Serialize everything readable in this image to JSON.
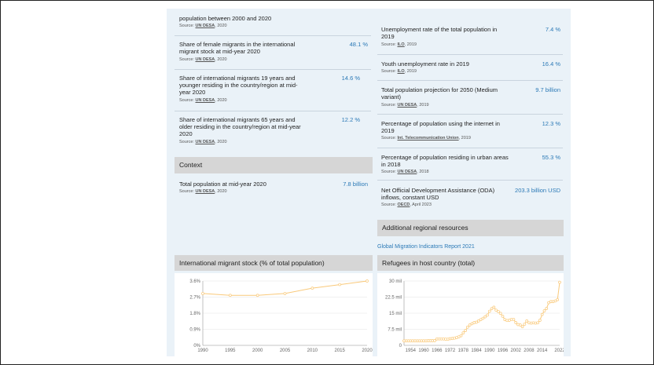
{
  "left_stats": [
    {
      "label": "population between 2000 and 2020",
      "value": "",
      "source_prefix": "Source:",
      "source_org": "UN DESA",
      "source_suffix": ", 2020"
    },
    {
      "label": "Share of female migrants in the international migrant stock at mid-year 2020",
      "value": "48.1 %",
      "source_prefix": "Source:",
      "source_org": "UN DESA",
      "source_suffix": ", 2020"
    },
    {
      "label": "Share of international migrants 19 years and younger residing in the country/region at mid-year 2020",
      "value": "14.6 %",
      "source_prefix": "Source:",
      "source_org": "UN DESA",
      "source_suffix": ", 2020"
    },
    {
      "label": "Share of international migrants 65 years and older residing in the country/region at mid-year 2020",
      "value": "12.2 %",
      "source_prefix": "Source:",
      "source_org": "UN DESA",
      "source_suffix": ", 2020"
    }
  ],
  "context": {
    "header": "Context",
    "items": [
      {
        "label": "Total population at mid-year 2020",
        "value": "7.8 billion",
        "source_prefix": "Source:",
        "source_org": "UN DESA",
        "source_suffix": ", 2020"
      }
    ]
  },
  "right_stats": [
    {
      "label": "Unemployment rate of the total population in 2019",
      "value": "7.4 %",
      "source_prefix": "Source:",
      "source_org": "ILO",
      "source_suffix": ", 2019"
    },
    {
      "label": "Youth unemployment rate in 2019",
      "value": "16.4 %",
      "source_prefix": "Source:",
      "source_org": "ILO",
      "source_suffix": ", 2019"
    },
    {
      "label": "Total population projection for 2050 (Medium variant)",
      "value": "9.7 billion",
      "source_prefix": "Source:",
      "source_org": "UN DESA",
      "source_suffix": ", 2019"
    },
    {
      "label": "Percentage of population using the internet in 2019",
      "value": "12.3 %",
      "source_prefix": "Source:",
      "source_org": "Int. Telecommunication Union",
      "source_suffix": ", 2019"
    },
    {
      "label": "Percentage of population residing in urban areas in 2018",
      "value": "55.3 %",
      "source_prefix": "Source:",
      "source_org": "UN DESA",
      "source_suffix": ", 2018"
    },
    {
      "label": "Net Official Development Assistance (ODA) inflows, constant USD",
      "value": "203.3 billion USD",
      "source_prefix": "Source:",
      "source_org": "OECD",
      "source_suffix": ", April 2023"
    }
  ],
  "regional": {
    "header": "Additional regional resources",
    "link": "Global Migration Indicators Report 2021"
  },
  "colors": {
    "accent": "#2b79b6",
    "line": "#f9c97a",
    "header_bg": "#d6d6d6",
    "panel_bg": "#eaf2f8"
  },
  "chart_data": [
    {
      "type": "line",
      "title": "International migrant stock (% of total population)",
      "x": [
        1990,
        1995,
        2000,
        2005,
        2010,
        2015,
        2020
      ],
      "y": [
        2.9,
        2.8,
        2.8,
        2.9,
        3.2,
        3.4,
        3.6
      ],
      "xlim": [
        1990,
        2020
      ],
      "ylim": [
        0,
        3.6
      ],
      "y_ticks": [
        "0%",
        "0.9%",
        "1.8%",
        "2.7%",
        "3.6%"
      ],
      "x_ticks": [
        "1990",
        "1995",
        "2000",
        "2005",
        "2010",
        "2015",
        "2020"
      ],
      "grid": true
    },
    {
      "type": "line",
      "title": "Refugees in host country (total)",
      "x": [
        1951,
        1952,
        1953,
        1954,
        1955,
        1956,
        1957,
        1958,
        1959,
        1960,
        1961,
        1962,
        1963,
        1964,
        1965,
        1966,
        1967,
        1968,
        1969,
        1970,
        1971,
        1972,
        1973,
        1974,
        1975,
        1976,
        1977,
        1978,
        1979,
        1980,
        1981,
        1982,
        1983,
        1984,
        1985,
        1986,
        1987,
        1988,
        1989,
        1990,
        1991,
        1992,
        1993,
        1994,
        1995,
        1996,
        1997,
        1998,
        1999,
        2000,
        2001,
        2002,
        2003,
        2004,
        2005,
        2006,
        2007,
        2008,
        2009,
        2010,
        2011,
        2012,
        2013,
        2014,
        2015,
        2016,
        2017,
        2018,
        2019,
        2020,
        2021,
        2022
      ],
      "y": [
        2.1,
        2.1,
        2.1,
        2.1,
        2.1,
        2.1,
        2.1,
        2.1,
        2.1,
        2.1,
        2.1,
        2.2,
        2.2,
        2.2,
        2.2,
        3.0,
        3.0,
        3.0,
        3.0,
        2.9,
        2.9,
        3.1,
        3.2,
        3.4,
        3.6,
        4.0,
        4.5,
        5.8,
        6.9,
        8.5,
        9.5,
        10.1,
        10.6,
        10.8,
        11.4,
        12.0,
        12.6,
        13.3,
        14.1,
        15.9,
        17.1,
        17.8,
        16.4,
        15.8,
        14.9,
        13.6,
        12.0,
        11.6,
        11.7,
        12.1,
        12.1,
        10.6,
        9.7,
        9.5,
        8.7,
        9.9,
        11.4,
        10.5,
        10.4,
        10.5,
        10.4,
        10.5,
        11.7,
        14.4,
        16.1,
        17.2,
        19.9,
        20.4,
        20.4,
        20.7,
        21.3,
        29.4
      ],
      "xlim": [
        1951,
        2022
      ],
      "ylim": [
        0,
        30
      ],
      "y_ticks": [
        "0",
        "7.5 mil",
        "15 mil",
        "22.5 mil",
        "30 mil"
      ],
      "x_ticks": [
        "1954",
        "1960",
        "1966",
        "1972",
        "1978",
        "1984",
        "1990",
        "1996",
        "2002",
        "2008",
        "2014",
        "2022"
      ],
      "grid": true
    }
  ]
}
